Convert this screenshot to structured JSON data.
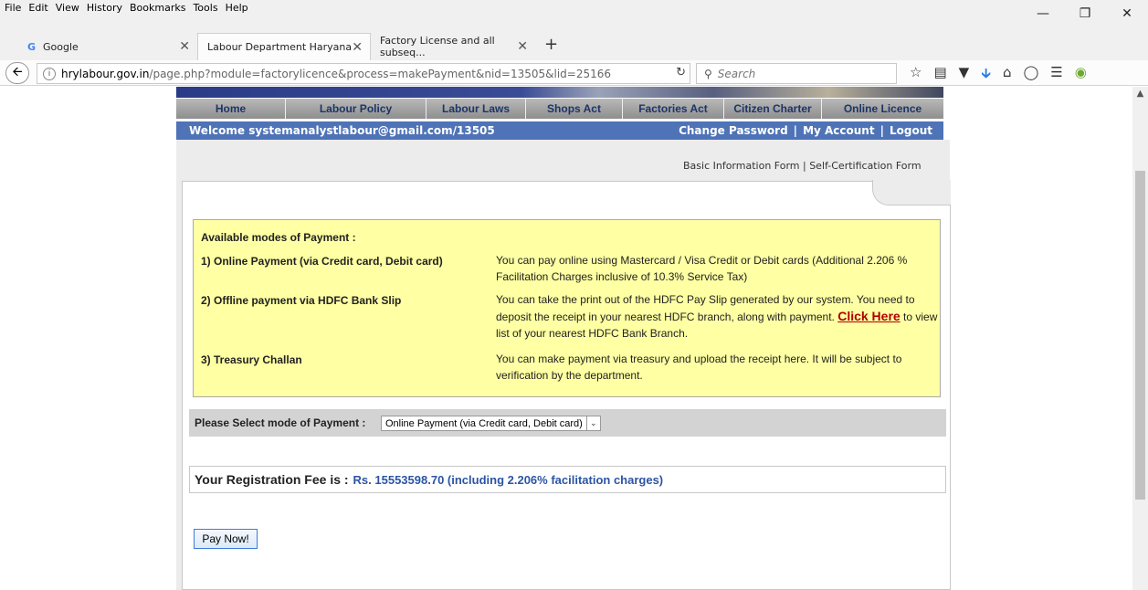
{
  "browser": {
    "menu": [
      "File",
      "Edit",
      "View",
      "History",
      "Bookmarks",
      "Tools",
      "Help"
    ],
    "tabs": [
      {
        "label": "Google",
        "favicon": "G"
      },
      {
        "label": "Labour Department Haryana"
      },
      {
        "label": "Factory License and all subseq..."
      }
    ],
    "url_host": "hrylabour.gov.in",
    "url_rest": "/page.php?module=factorylicence&process=makePayment&nid=13505&lid=25166",
    "search_placeholder": "Search"
  },
  "site": {
    "nav": [
      "Home",
      "Labour Policy",
      "Labour Laws",
      "Shops Act",
      "Factories Act",
      "Citizen Charter",
      "Online Licence"
    ],
    "welcome": "Welcome  systemanalystlabour@gmail.com/13505",
    "account_links": [
      "Change Password",
      "|",
      "My Account",
      "|",
      "Logout"
    ],
    "form_links": {
      "basic": "Basic Information Form",
      "sep": " | ",
      "self_cert": "Self-Certification Form"
    }
  },
  "payment": {
    "heading": "Available modes of Payment :",
    "modes": [
      {
        "label": "1) Online Payment (via Credit card, Debit card)",
        "desc": "You can pay online using Mastercard / Visa Credit or Debit cards (Additional 2.206 % Facilitation Charges inclusive of 10.3% Service Tax)"
      },
      {
        "label": "2) Offline payment via HDFC Bank Slip",
        "desc_pre": "You can take the print out of the HDFC Pay Slip generated by our system. You need to deposit the receipt in your nearest HDFC branch, along with payment. ",
        "link": "Click Here",
        "desc_post": " to view list of your nearest HDFC Bank Branch."
      },
      {
        "label": "3) Treasury Challan",
        "desc": "You can make payment via treasury and upload the receipt here. It will be subject to verification by the department."
      }
    ],
    "select_label": "Please Select mode of Payment :",
    "select_value": "Online Payment (via Credit card, Debit card)",
    "fee_label": "Your Registration Fee is :",
    "fee_value": "Rs. 15553598.70 (including 2.206% facilitation charges)",
    "pay_button": "Pay Now!"
  }
}
